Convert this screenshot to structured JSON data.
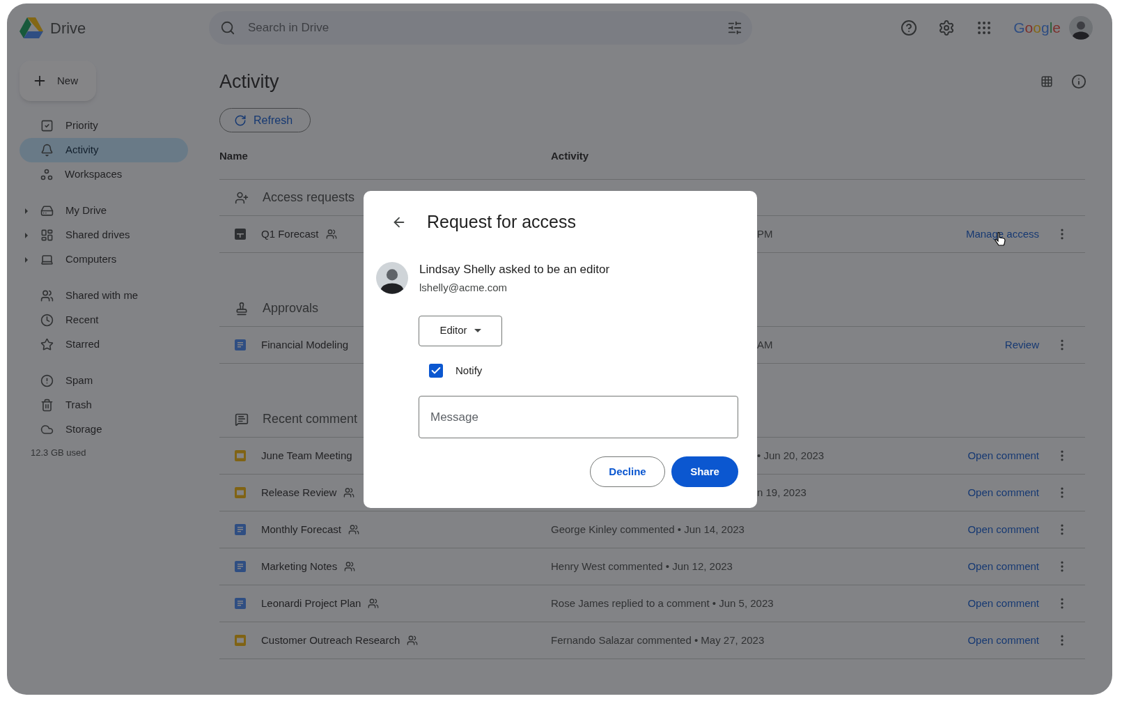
{
  "header": {
    "app_name": "Drive",
    "search": {
      "placeholder": "Search in Drive"
    },
    "brand": "Google"
  },
  "sidebar": {
    "new_button": "New",
    "groups": [
      [
        {
          "label": "Priority",
          "selected": false,
          "expandable": false
        },
        {
          "label": "Activity",
          "selected": true,
          "expandable": false
        },
        {
          "label": "Workspaces",
          "selected": false,
          "expandable": false
        }
      ],
      [
        {
          "label": "My Drive",
          "selected": false,
          "expandable": true
        },
        {
          "label": "Shared drives",
          "selected": false,
          "expandable": true
        },
        {
          "label": "Computers",
          "selected": false,
          "expandable": true
        }
      ],
      [
        {
          "label": "Shared with me",
          "selected": false,
          "expandable": false
        },
        {
          "label": "Recent",
          "selected": false,
          "expandable": false
        },
        {
          "label": "Starred",
          "selected": false,
          "expandable": false
        }
      ],
      [
        {
          "label": "Spam",
          "selected": false,
          "expandable": false
        },
        {
          "label": "Trash",
          "selected": false,
          "expandable": false
        },
        {
          "label": "Storage",
          "selected": false,
          "expandable": false
        }
      ]
    ],
    "storage_used": "12.3 GB used"
  },
  "main": {
    "title": "Activity",
    "refresh_button": "Refresh",
    "columns": [
      "Name",
      "Activity"
    ],
    "sections": [
      {
        "title": "Access requests",
        "rows": [
          {
            "name": "Q1 Forecast",
            "kind": "sheet",
            "shared": true,
            "activity": "PM",
            "activity_clipped": true,
            "action": "Manage access"
          }
        ]
      },
      {
        "title": "Approvals",
        "rows": [
          {
            "name": "Financial Modeling",
            "kind": "doc",
            "shared": false,
            "activity": "AM",
            "activity_clipped": true,
            "action": "Review"
          }
        ]
      },
      {
        "title": "Recent comment",
        "rows": [
          {
            "name": "June Team Meeting",
            "kind": "slides",
            "shared": false,
            "activity": "• Jun 20, 2023",
            "activity_clipped": true,
            "action": "Open comment"
          },
          {
            "name": "Release Review",
            "kind": "slides",
            "shared": true,
            "activity": "n 19, 2023",
            "activity_clipped": true,
            "action": "Open comment"
          },
          {
            "name": "Monthly Forecast",
            "kind": "doc",
            "shared": true,
            "activity": "George Kinley commented • Jun 14, 2023",
            "activity_clipped": false,
            "action": "Open comment"
          },
          {
            "name": "Marketing Notes",
            "kind": "doc",
            "shared": true,
            "activity": "Henry West commented • Jun 12, 2023",
            "activity_clipped": false,
            "action": "Open comment"
          },
          {
            "name": "Leonardi Project Plan",
            "kind": "doc",
            "shared": true,
            "activity": "Rose James replied to a comment • Jun 5, 2023",
            "activity_clipped": false,
            "action": "Open comment"
          },
          {
            "name": "Customer Outreach Research",
            "kind": "slides",
            "shared": true,
            "activity": "Fernando Salazar commented • May 27, 2023",
            "activity_clipped": false,
            "action": "Open comment"
          }
        ]
      }
    ]
  },
  "dialog": {
    "title": "Request for access",
    "requester": "Lindsay Shelly asked to be an editor",
    "email": "lshelly@acme.com",
    "role": "Editor",
    "notify": {
      "label": "Notify",
      "checked": true
    },
    "message": {
      "placeholder": "Message"
    },
    "buttons": [
      {
        "label": "Decline",
        "kind": "outlined"
      },
      {
        "label": "Share",
        "kind": "filled"
      }
    ]
  }
}
